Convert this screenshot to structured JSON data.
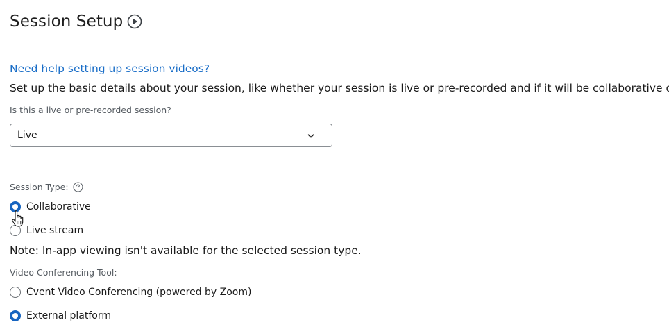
{
  "header": {
    "title": "Session Setup",
    "title_icon": "play-circle-icon"
  },
  "help": {
    "link_text": "Need help setting up session videos?"
  },
  "description": "Set up the basic details about your session, like whether your session is live or pre-recorded and if it will be collaborative or not.",
  "session_mode": {
    "label": "Is this a live or pre-recorded session?",
    "selected": "Live"
  },
  "session_type": {
    "label": "Session Type:",
    "options": [
      {
        "label": "Collaborative",
        "checked": true
      },
      {
        "label": "Live stream",
        "checked": false
      }
    ]
  },
  "note": "Note: In-app viewing isn't available for the selected session type.",
  "video_tool": {
    "label": "Video Conferencing Tool:",
    "options": [
      {
        "label": "Cvent Video Conferencing (powered by Zoom)",
        "checked": false
      },
      {
        "label": "External platform",
        "checked": true
      }
    ]
  },
  "colors": {
    "accent": "#1664c0",
    "link": "#1a6ec8",
    "label": "#555b61"
  }
}
